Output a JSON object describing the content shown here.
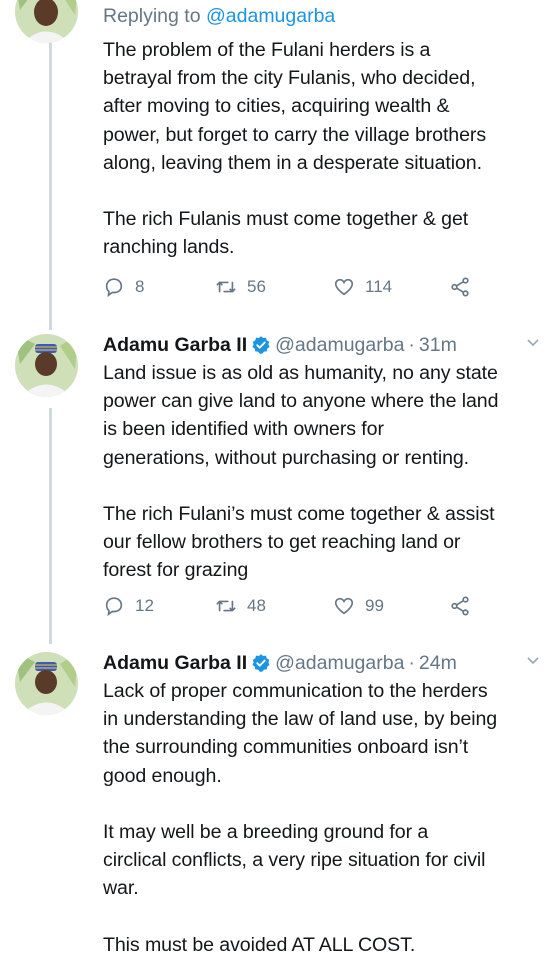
{
  "tweets": [
    {
      "reply_prefix": "Replying to ",
      "reply_handle": "@adamugarba",
      "text": "The problem of the Fulani herders is a\nbetrayal from the city Fulanis, who decided,\nafter moving to cities, acquiring wealth &\npower, but forget to carry the village brothers\nalong, leaving them in a desperate situation.\n\nThe rich Fulanis must come together & get\nranching lands.",
      "replies": "8",
      "retweets": "56",
      "likes": "114"
    },
    {
      "name": "Adamu Garba II",
      "handle": "@adamugarba",
      "separator": "·",
      "time": "31m",
      "text": "Land issue is as old as humanity, no any state\npower can give land to anyone where the land\nis been identified with owners for\ngenerations, without purchasing or renting.\n\nThe rich Fulani’s must come together & assist\nour fellow brothers to get reaching land or\nforest for grazing",
      "replies": "12",
      "retweets": "48",
      "likes": "99"
    },
    {
      "name": "Adamu Garba II",
      "handle": "@adamugarba",
      "separator": "·",
      "time": "24m",
      "text": "Lack of proper communication to the herders\nin understanding the law of land use, by being\nthe surrounding communities onboard isn’t\ngood enough.\n\nIt may well be a breeding ground for a\ncirclical conflicts, a very ripe situation for civil\nwar.\n\nThis must be avoided AT ALL COST."
    }
  ],
  "colors": {
    "accent": "#1b95e0",
    "muted": "#657786",
    "text": "#14171a",
    "thread": "#cfd9de"
  },
  "icons": [
    "reply-icon",
    "retweet-icon",
    "like-icon",
    "share-icon",
    "verified-badge-icon",
    "chevron-down-icon"
  ]
}
